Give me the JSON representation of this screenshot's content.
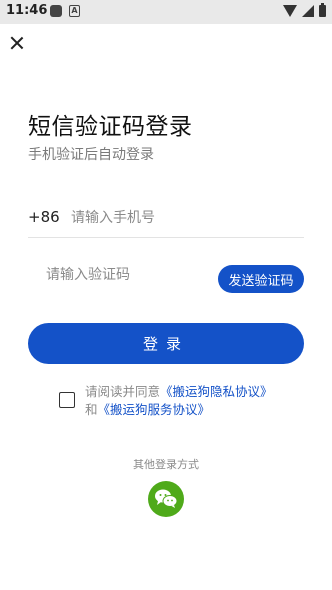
{
  "status_bar": {
    "time": "11:46",
    "notif_letter": "A"
  },
  "header": {
    "title": "短信验证码登录",
    "subtitle": "手机验证后自动登录"
  },
  "phone": {
    "country_code": "+86",
    "placeholder": "请输入手机号"
  },
  "code": {
    "placeholder": "请输入验证码",
    "send_label": "发送验证码"
  },
  "login": {
    "label": "登录"
  },
  "agreement": {
    "prefix": "请阅读并同意",
    "privacy_link": "《搬运狗隐私协议》",
    "and": "和",
    "service_link": "《搬运狗服务协议》"
  },
  "other": {
    "label": "其他登录方式"
  },
  "colors": {
    "primary": "#1452c8",
    "wechat": "#4faa1a"
  },
  "icons": [
    "close-icon",
    "wechat-icon",
    "wifi-icon",
    "signal-icon",
    "battery-icon"
  ]
}
